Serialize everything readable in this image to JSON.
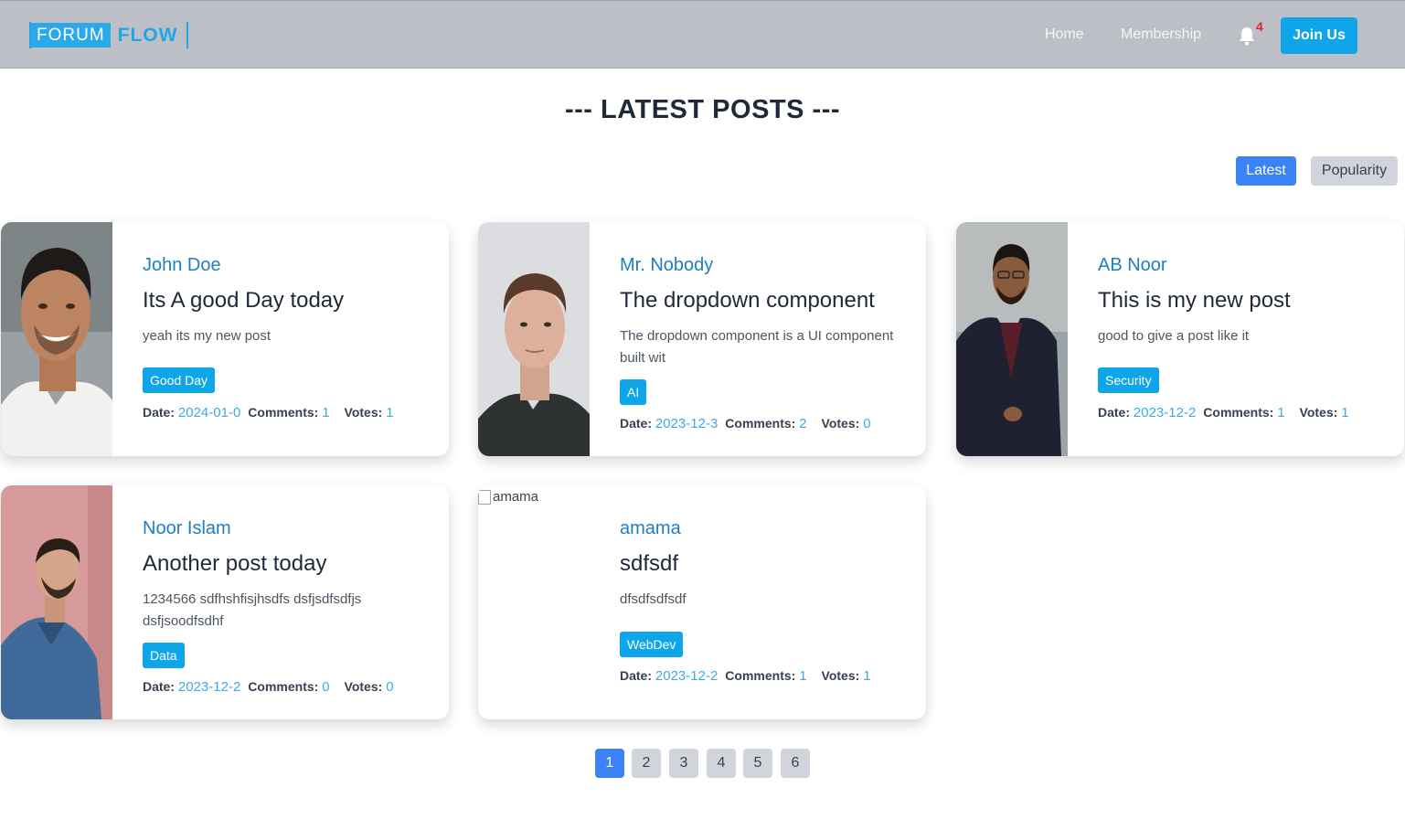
{
  "nav": {
    "logo_part1": "FORUM",
    "logo_part2": "FLOW",
    "home": "Home",
    "membership": "Membership",
    "notification_count": "4",
    "join": "Join Us"
  },
  "page": {
    "title": "--- LATEST POSTS ---"
  },
  "sort": {
    "latest": "Latest",
    "popularity": "Popularity",
    "active": "Latest"
  },
  "meta_labels": {
    "date": "Date:",
    "comments": "Comments:",
    "votes": "Votes:"
  },
  "posts": [
    {
      "author": "John Doe",
      "title": "Its A good Day today",
      "description": "yeah its my new post",
      "tag": "Good Day",
      "date": "2024-01-0",
      "comments": "1",
      "votes": "1"
    },
    {
      "author": "Mr. Nobody",
      "title": "The dropdown component",
      "description": "The dropdown component is a UI component built wit",
      "tag": "AI",
      "date": "2023-12-3",
      "comments": "2",
      "votes": "0"
    },
    {
      "author": "AB Noor",
      "title": "This is my new post",
      "description": "good to give a post like it",
      "tag": "Security",
      "date": "2023-12-2",
      "comments": "1",
      "votes": "1"
    },
    {
      "author": "Noor Islam",
      "title": "Another post today",
      "description": "1234566 sdfhshfisjhsdfs dsfjsdfsdfjs dsfjsoodfsdhf",
      "tag": "Data",
      "date": "2023-12-2",
      "comments": "0",
      "votes": "0"
    },
    {
      "author": "amama",
      "title": "sdfsdf",
      "description": "dfsdfsdfsdf",
      "tag": "WebDev",
      "date": "2023-12-2",
      "comments": "1",
      "votes": "1",
      "image_alt": "amama"
    }
  ],
  "pagination": {
    "pages": [
      "1",
      "2",
      "3",
      "4",
      "5",
      "6"
    ],
    "current": "1"
  },
  "colors": {
    "navbar": "#bcc0c6",
    "accent": "#0ea5e9",
    "primary": "#3b82f6",
    "author": "#1d7fc0",
    "meta_value": "#3fa9e8",
    "notification": "#dc2626"
  }
}
